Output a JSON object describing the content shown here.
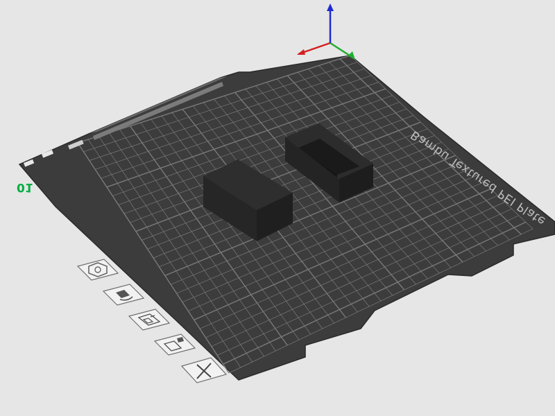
{
  "plate": {
    "label": "Bambu Textured PEI Plate",
    "number": "01",
    "number_color": "#00ae42",
    "surface_color": "#3c3c3c",
    "grid_color": "#7a7a7a"
  },
  "axes": {
    "x_color": "#d31f1f",
    "y_color": "#1fae2f",
    "z_color": "#1f2bd3"
  },
  "objects": [
    {
      "name": "solid-box"
    },
    {
      "name": "open-tray"
    }
  ],
  "plate_tools": [
    {
      "icon": "arrange-icon"
    },
    {
      "icon": "orient-icon"
    },
    {
      "icon": "layout-icon"
    },
    {
      "icon": "plate-settings-icon"
    },
    {
      "icon": "delete-plate-icon"
    }
  ]
}
